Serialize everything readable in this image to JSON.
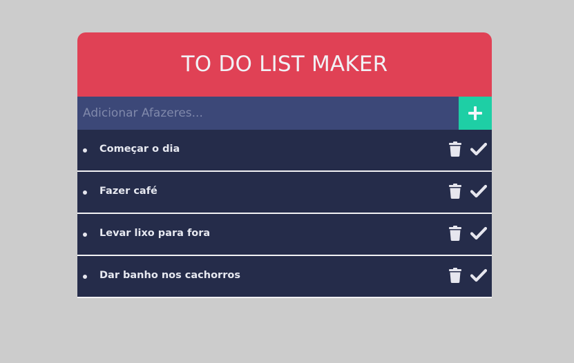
{
  "header": {
    "title": "TO DO LIST MAKER"
  },
  "input": {
    "placeholder": "Adicionar Afazeres...",
    "value": "",
    "add_icon": "plus-icon"
  },
  "todos": [
    {
      "text": "Começar o dia"
    },
    {
      "text": "Fazer café"
    },
    {
      "text": "Levar lixo para fora"
    },
    {
      "text": "Dar banho nos cachorros"
    }
  ],
  "item_icons": {
    "delete": "trash-icon",
    "complete": "check-icon"
  },
  "colors": {
    "background": "#cccccc",
    "header": "#e04155",
    "input": "#3c4878",
    "add_button": "#1ecfa5",
    "item": "#252c4a",
    "text": "#e6e8f0"
  }
}
